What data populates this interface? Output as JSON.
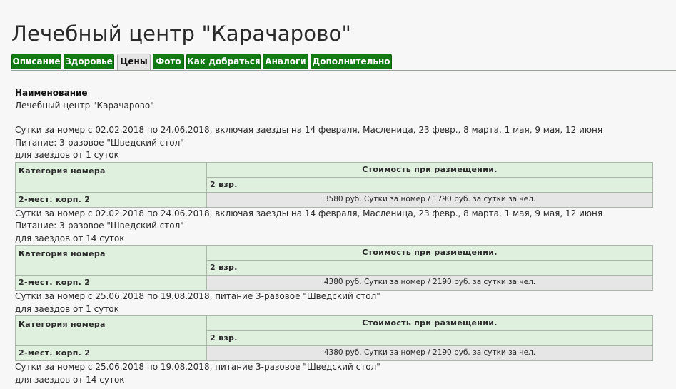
{
  "page": {
    "title": "Лечебный центр \"Карачарово\""
  },
  "tabs": [
    {
      "label": "Описание",
      "active": false
    },
    {
      "label": "Здоровье",
      "active": false
    },
    {
      "label": "Цены",
      "active": true
    },
    {
      "label": "Фото",
      "active": false
    },
    {
      "label": "Как добраться",
      "active": false
    },
    {
      "label": "Аналоги",
      "active": false
    },
    {
      "label": "Дополнительно",
      "active": false
    }
  ],
  "content": {
    "name_label": "Наименование",
    "name_value": "Лечебный центр \"Карачарово\"",
    "table_headers": {
      "category": "Категория номера",
      "cost": "Стоимость при размещении.",
      "adults": "2 взр."
    },
    "blocks": [
      {
        "period": "Сутки за номер с 02.02.2018 по 24.06.2018, включая заезды на 14 февраля, Масленица, 23 февр., 8 марта, 1 мая, 9 мая, 12 июня",
        "meals": "Питание: 3-разовое \"Шведский стол\"",
        "stay": "для заездов от 1 суток",
        "room": "2-мест. корп. 2",
        "price": "3580 руб. Сутки за номер / 1790 руб. за сутки за чел."
      },
      {
        "period": "Сутки за номер с 02.02.2018 по 24.06.2018, включая заезды на 14 февраля, Масленица, 23 февр., 8 марта, 1 мая, 9 мая, 12 июня",
        "meals": "Питание: 3-разовое \"Шведский стол\"",
        "stay": "для заездов от 14 суток",
        "room": "2-мест. корп. 2",
        "price": "4380 руб. Сутки за номер / 2190 руб. за сутки за чел."
      },
      {
        "period": "Сутки за номер с 25.06.2018 по 19.08.2018, питание 3-разовое \"Шведский стол\"",
        "stay": "для заездов от 1 суток",
        "room": "2-мест. корп. 2",
        "price": "4380 руб. Сутки за номер / 2190 руб. за сутки за чел."
      },
      {
        "period": "Сутки за номер с 25.06.2018 по 19.08.2018, питание 3-разовое \"Шведский стол\"",
        "stay": "для заездов от 14 суток"
      }
    ]
  },
  "colors": {
    "tab_green": "#127a12",
    "tab_active": "#e4e4e4",
    "table_header_bg": "#dff0df",
    "price_cell_bg": "#e6e6e6"
  }
}
